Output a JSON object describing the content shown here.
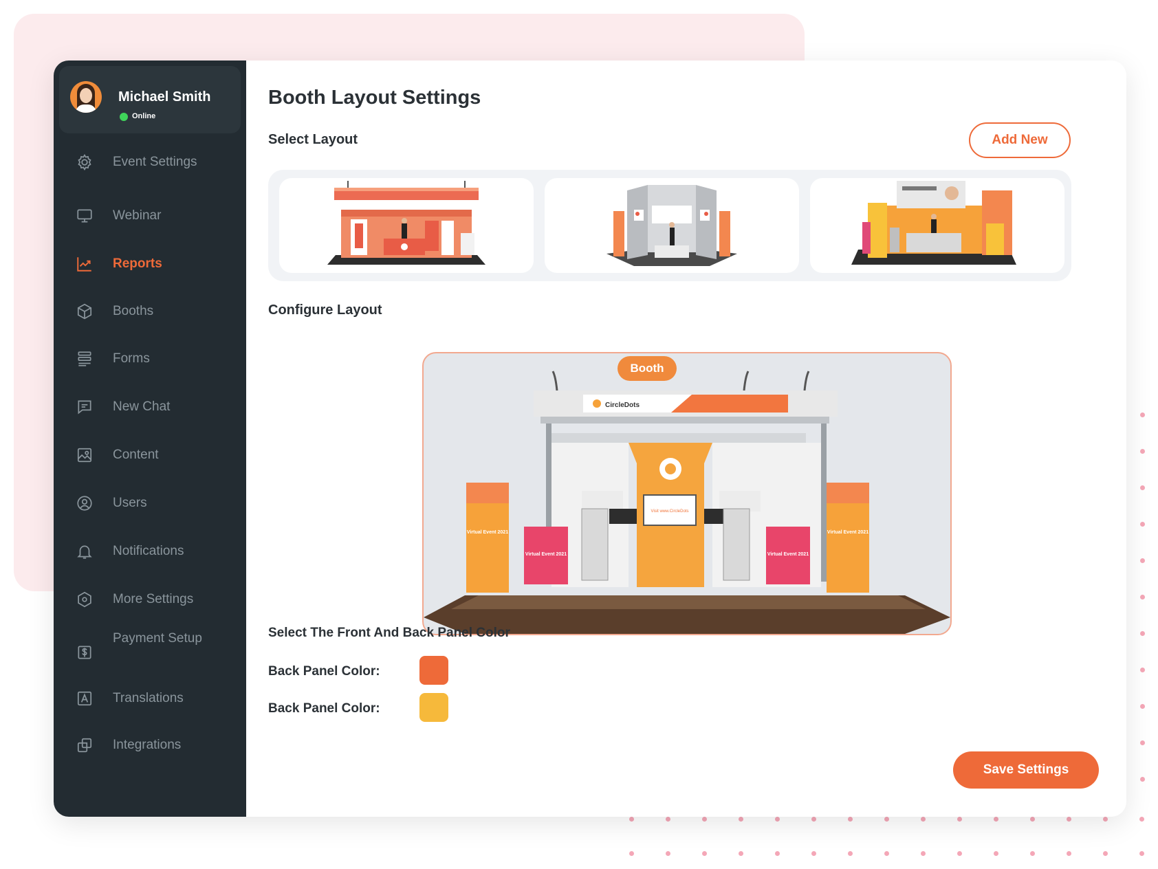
{
  "profile": {
    "name": "Michael Smith",
    "status": "Online"
  },
  "sidebar": {
    "items": [
      {
        "label": "Event Settings",
        "icon": "gear-icon",
        "active": false
      },
      {
        "label": "Webinar",
        "icon": "monitor-icon",
        "active": false
      },
      {
        "label": "Reports",
        "icon": "chart-icon",
        "active": true
      },
      {
        "label": "Booths",
        "icon": "cube-icon",
        "active": false
      },
      {
        "label": "Forms",
        "icon": "form-icon",
        "active": false
      },
      {
        "label": "New Chat",
        "icon": "chat-icon",
        "active": false
      },
      {
        "label": "Content",
        "icon": "image-icon",
        "active": false
      },
      {
        "label": "Users",
        "icon": "user-icon",
        "active": false
      },
      {
        "label": "Notifications",
        "icon": "bell-icon",
        "active": false
      },
      {
        "label": "More Settings",
        "icon": "hexagon-settings-icon",
        "active": false
      },
      {
        "label": "Payment Setup",
        "icon": "dollar-icon",
        "active": false
      },
      {
        "label": "Translations",
        "icon": "translate-icon",
        "active": false
      },
      {
        "label": "Integrations",
        "icon": "integrations-icon",
        "active": false
      }
    ]
  },
  "main": {
    "title": "Booth Layout Settings",
    "select_layout_label": "Select Layout",
    "add_new_label": "Add New",
    "configure_label": "Configure Layout",
    "booth_tag": "Booth",
    "booth_brand": "CircleDots",
    "booth_screen_text": "Visit www.CircleDots",
    "banner_text": "Virtual Event 2021",
    "panel_section_label": "Select The Front And Back Panel Color",
    "panel_colors": [
      {
        "label": "Back Panel Color:",
        "color": "#ee6a39"
      },
      {
        "label": "Back Panel Color:",
        "color": "#f6b93b"
      }
    ],
    "save_label": "Save Settings"
  },
  "colors": {
    "accent": "#ee6a39",
    "sidebar_bg": "#232c32",
    "pink_bg": "#fcebed"
  }
}
